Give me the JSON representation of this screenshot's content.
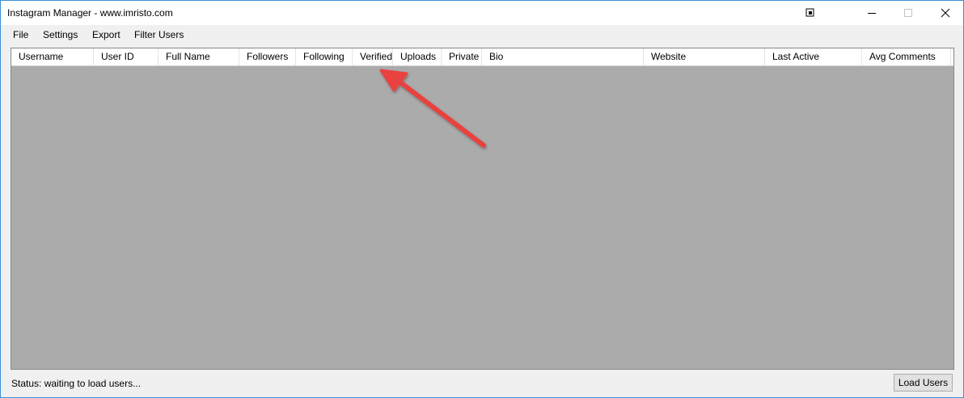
{
  "window": {
    "title": "Instagram Manager - www.imristo.com"
  },
  "menu": {
    "items": [
      "File",
      "Settings",
      "Export",
      "Filter Users"
    ]
  },
  "table": {
    "columns": [
      "Username",
      "User ID",
      "Full Name",
      "Followers",
      "Following",
      "Verified",
      "Uploads",
      "Private",
      "Bio",
      "Website",
      "Last Active",
      "Avg Comments"
    ],
    "rows": []
  },
  "status": {
    "text": "Status: waiting to load users..."
  },
  "buttons": {
    "load_users": "Load Users"
  },
  "colors": {
    "accent_border": "#3c8fd6",
    "grid_background": "#ababab",
    "annotation_arrow": "#e8433f"
  },
  "icons": {
    "titlebar": [
      "pin-icon",
      "minimize-icon",
      "maximize-icon",
      "close-icon"
    ],
    "annotation": "arrow-icon"
  }
}
